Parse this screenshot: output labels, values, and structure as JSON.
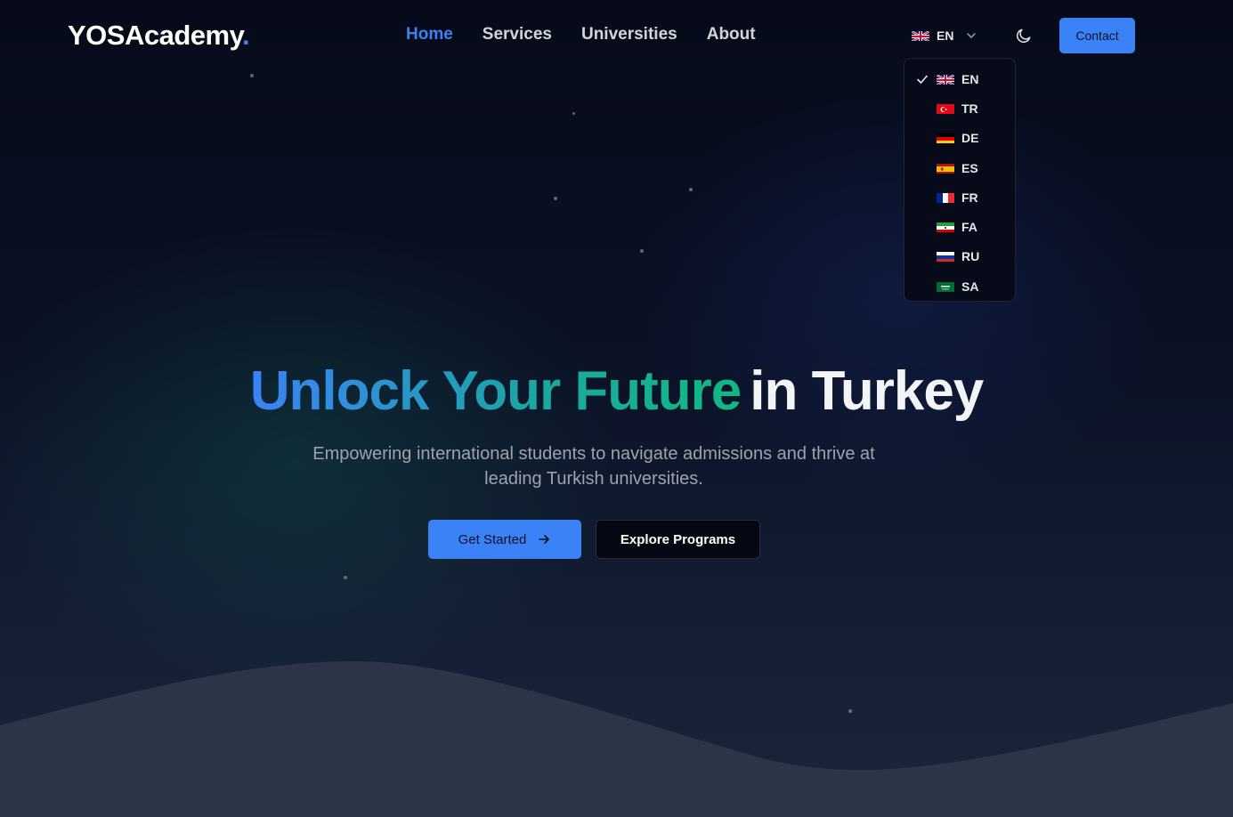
{
  "brand": {
    "name": "YOSAcademy",
    "dot": ".",
    "accent_color": "#3b82f6"
  },
  "nav": {
    "items": [
      {
        "label": "Home",
        "active": true
      },
      {
        "label": "Services",
        "active": false
      },
      {
        "label": "Universities",
        "active": false
      },
      {
        "label": "About",
        "active": false
      }
    ]
  },
  "language": {
    "current": "EN",
    "current_flag": "uk-flag-icon",
    "options": [
      {
        "code": "EN",
        "flag": "uk-flag-icon",
        "selected": true
      },
      {
        "code": "TR",
        "flag": "turkey-flag-icon",
        "selected": false
      },
      {
        "code": "DE",
        "flag": "germany-flag-icon",
        "selected": false
      },
      {
        "code": "ES",
        "flag": "spain-flag-icon",
        "selected": false
      },
      {
        "code": "FR",
        "flag": "france-flag-icon",
        "selected": false
      },
      {
        "code": "FA",
        "flag": "iran-flag-icon",
        "selected": false
      },
      {
        "code": "RU",
        "flag": "russia-flag-icon",
        "selected": false
      },
      {
        "code": "SA",
        "flag": "saudi-arabia-flag-icon",
        "selected": false
      }
    ]
  },
  "header": {
    "theme_toggle_icon": "moon-icon",
    "contact_label": "Contact"
  },
  "hero": {
    "title_gradient": "Unlock Your Future",
    "title_plain": "in Turkey",
    "subtitle": "Empowering international students to navigate admissions and thrive at leading Turkish universities.",
    "primary_cta": "Get Started",
    "primary_cta_icon": "arrow-right-icon",
    "secondary_cta": "Explore Programs"
  },
  "colors": {
    "primary": "#3b82f6",
    "gradient_start": "#3b82f6",
    "gradient_end": "#10b981",
    "background": "#070b1a"
  }
}
